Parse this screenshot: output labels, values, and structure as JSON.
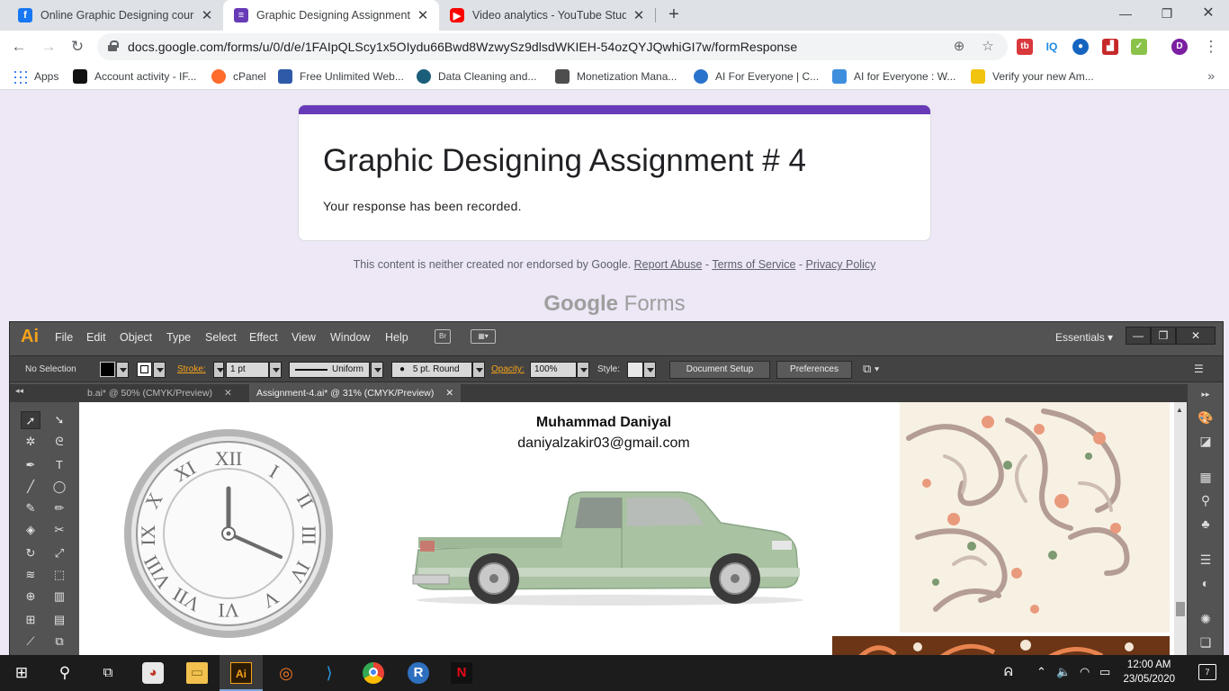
{
  "browser": {
    "tabs": [
      {
        "title": "Online Graphic Designing course",
        "favicon": "facebook-icon"
      },
      {
        "title": "Graphic Designing Assignment #",
        "favicon": "google-forms-icon"
      },
      {
        "title": "Video analytics - YouTube Studio",
        "favicon": "youtube-icon"
      }
    ],
    "url": "docs.google.com/forms/u/0/d/e/1FAIpQLScy1x5OIydu66Bwd8WzwySz9dlsdWKIEH-54ozQYJQwhiGI7w/formResponse",
    "bookmarks": [
      {
        "label": "Apps"
      },
      {
        "label": "Account activity - IF..."
      },
      {
        "label": "cPanel"
      },
      {
        "label": "Free Unlimited Web..."
      },
      {
        "label": "Data Cleaning and..."
      },
      {
        "label": "Monetization Mana..."
      },
      {
        "label": "AI For Everyone | C..."
      },
      {
        "label": "AI for Everyone : W..."
      },
      {
        "label": "Verify your new Am..."
      }
    ]
  },
  "form": {
    "title": "Graphic Designing Assignment # 4",
    "message": "Your response has been recorded.",
    "disclaimer_prefix": "This content is neither created nor endorsed by Google.",
    "report_abuse": "Report Abuse",
    "terms": "Terms of Service",
    "privacy": "Privacy Policy",
    "sep": "-",
    "brand_google": "Google",
    "brand_forms": "Forms",
    "accent": "#673ab7"
  },
  "illustrator": {
    "logo": "Ai",
    "menu": [
      "File",
      "Edit",
      "Object",
      "Type",
      "Select",
      "Effect",
      "View",
      "Window",
      "Help"
    ],
    "bridge": "Br",
    "workspace": "Essentials",
    "control": {
      "selection": "No Selection",
      "stroke_label": "Stroke:",
      "stroke_value": "1 pt",
      "profile": "Uniform",
      "brush": "5 pt. Round",
      "opacity_label": "Opacity:",
      "opacity_value": "100%",
      "style_label": "Style:",
      "document_setup": "Document Setup",
      "preferences": "Preferences"
    },
    "doc_tabs": [
      {
        "label": "b.ai* @ 50% (CMYK/Preview)"
      },
      {
        "label": "Assignment-4.ai* @ 31% (CMYK/Preview)"
      }
    ],
    "artboard": {
      "author": "Muhammad Daniyal",
      "email": "daniyalzakir03@gmail.com"
    }
  },
  "taskbar": {
    "time": "12:00 AM",
    "date": "23/05/2020",
    "notifications": "7"
  }
}
